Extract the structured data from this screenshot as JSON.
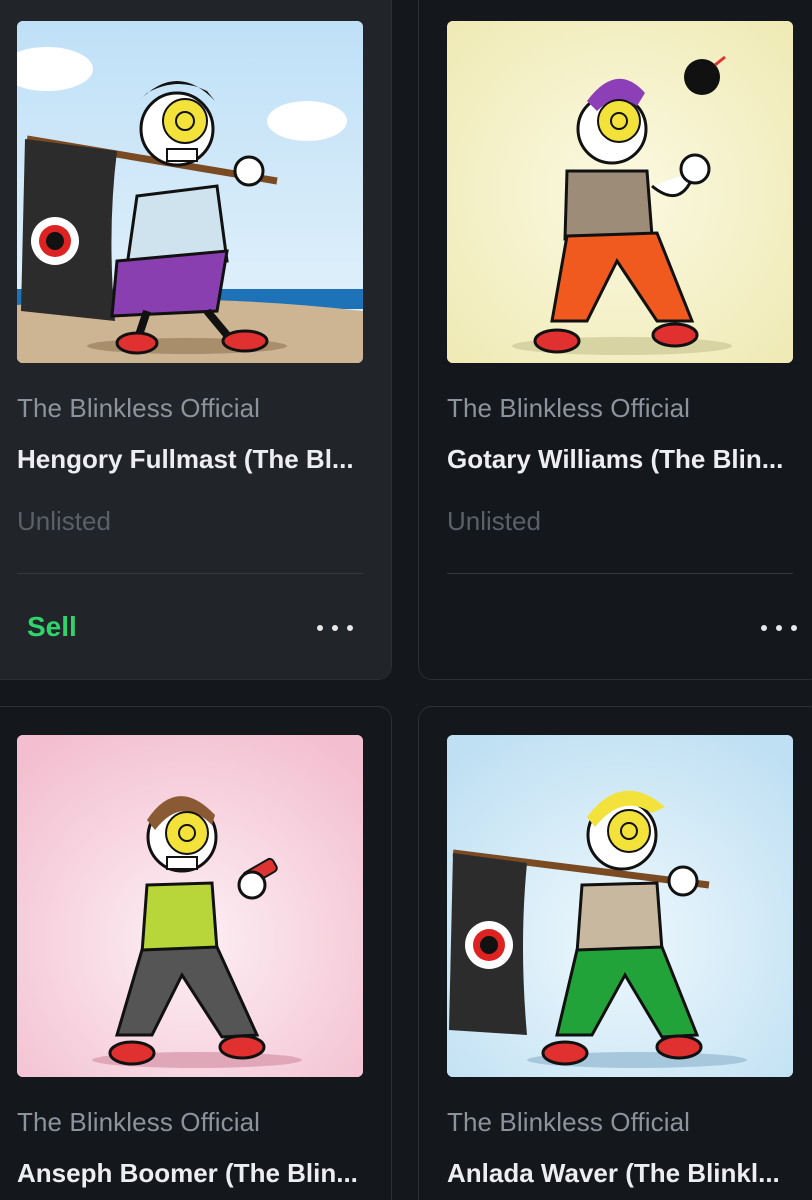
{
  "cards": [
    {
      "collection": "The Blinkless Official",
      "title": "Hengory Fullmast (The Bl...",
      "status": "Unlisted",
      "sell_label": "Sell",
      "more_icon": "more-horizontal-icon",
      "art_bg": "#cfe6f5"
    },
    {
      "collection": "The Blinkless Official",
      "title": "Gotary Williams (The Blin...",
      "status": "Unlisted",
      "more_icon": "more-horizontal-icon",
      "art_bg": "#f4f2c9"
    },
    {
      "collection": "The Blinkless Official",
      "title": "Anseph Boomer (The Blin...",
      "art_bg": "#f7cfdc"
    },
    {
      "collection": "The Blinkless Official",
      "title": "Anlada Waver (The Blinkl...",
      "art_bg": "#cde7f6"
    }
  ],
  "colors": {
    "page_bg": "#14171b",
    "card_hover_bg": "#212429",
    "sell_green": "#2fd46b",
    "muted_text": "#8d939c"
  }
}
